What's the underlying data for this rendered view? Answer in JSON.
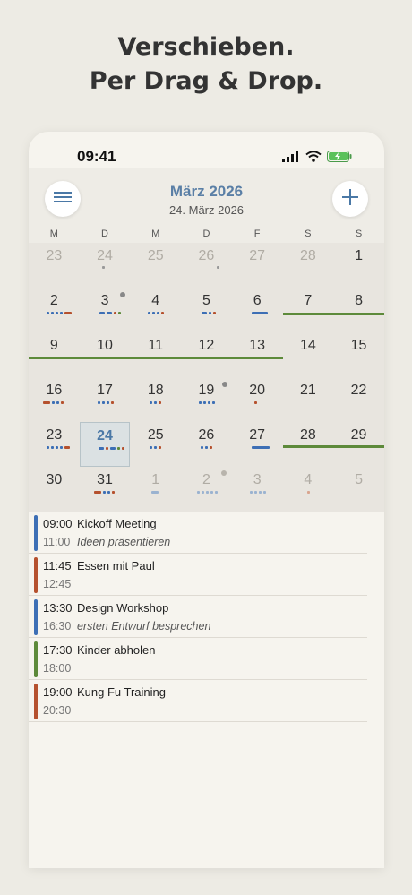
{
  "headline": {
    "line1": "Verschieben.",
    "line2": "Per Drag & Drop."
  },
  "status": {
    "time": "09:41"
  },
  "header": {
    "month": "März 2026",
    "selected_date": "24. März 2026",
    "menu_icon": "hamburger-menu-icon",
    "add_icon": "plus-icon"
  },
  "weekdays": [
    "M",
    "D",
    "M",
    "D",
    "F",
    "S",
    "S"
  ],
  "weeks": [
    [
      "23",
      "24",
      "25",
      "26",
      "27",
      "28",
      "1"
    ],
    [
      "2",
      "3",
      "4",
      "5",
      "6",
      "7",
      "8"
    ],
    [
      "9",
      "10",
      "11",
      "12",
      "13",
      "14",
      "15"
    ],
    [
      "16",
      "17",
      "18",
      "19",
      "20",
      "21",
      "22"
    ],
    [
      "23",
      "24",
      "25",
      "26",
      "27",
      "28",
      "29"
    ],
    [
      "30",
      "31",
      "1",
      "2",
      "3",
      "4",
      "5"
    ]
  ],
  "events": [
    {
      "start": "09:00",
      "title": "Kickoff Meeting",
      "end": "11:00",
      "note": "Ideen präsentieren",
      "color": "#3d6fb5"
    },
    {
      "start": "11:45",
      "title": "Essen mit Paul",
      "end": "12:45",
      "note": "",
      "color": "#b5512e"
    },
    {
      "start": "13:30",
      "title": "Design Workshop",
      "end": "16:30",
      "note": "ersten Entwurf besprechen",
      "color": "#3d6fb5"
    },
    {
      "start": "17:30",
      "title": "Kinder abholen",
      "end": "18:00",
      "note": "",
      "color": "#5d8a3a"
    },
    {
      "start": "19:00",
      "title": "Kung Fu Training",
      "end": "20:30",
      "note": "",
      "color": "#b5512e"
    }
  ],
  "colors": {
    "blue": "#3d6fb5",
    "red": "#b5512e",
    "green": "#5d8a3a",
    "accent": "#5a7fa6"
  }
}
